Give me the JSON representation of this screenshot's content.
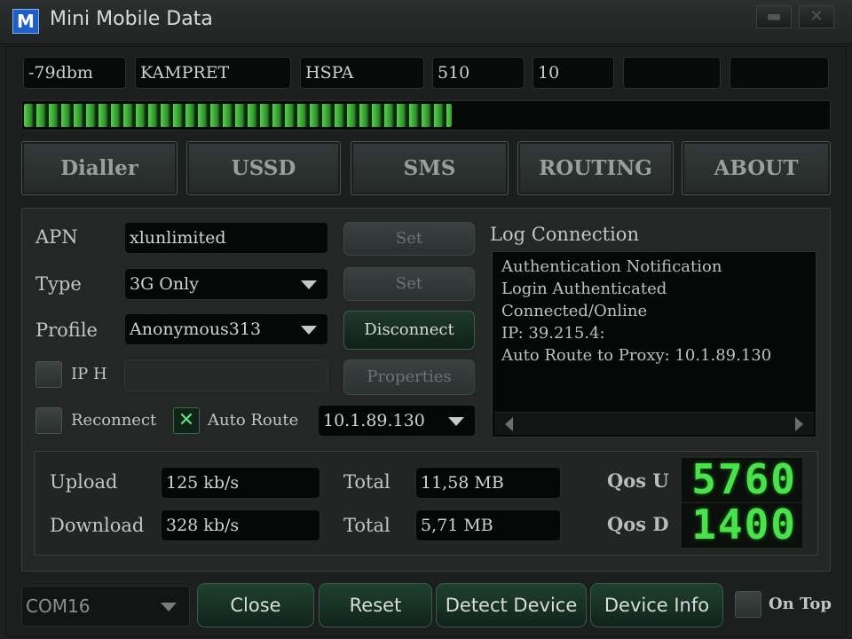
{
  "window": {
    "icon_letter": "M",
    "title": "Mini Mobile Data",
    "minimize_glyph": "▬",
    "close_glyph": "✕"
  },
  "status": {
    "signal": "-79dbm",
    "operator": "KAMPRET",
    "network": "HSPA",
    "mcc": "510",
    "mnc": "10",
    "extra1": "",
    "extra2": ""
  },
  "signal_strength_percent": 53,
  "tabs": [
    "Dialler",
    "USSD",
    "SMS",
    "ROUTING",
    "ABOUT"
  ],
  "dialler": {
    "apn_label": "APN",
    "apn_value": "xlunlimited",
    "apn_set": "Set",
    "type_label": "Type",
    "type_value": "3G Only",
    "type_set": "Set",
    "profile_label": "Profile",
    "profile_value": "Anonymous313",
    "disconnect": "Disconnect",
    "iph_label": "IP H",
    "iph_value": "",
    "properties": "Properties",
    "reconnect_label": "Reconnect",
    "reconnect_checked": false,
    "autoroute_label": "Auto Route",
    "autoroute_checked": true,
    "autoroute_check_glyph": "✕",
    "autoroute_value": "10.1.89.130"
  },
  "log": {
    "title": "Log Connection",
    "lines": [
      "Authentication Notification",
      "Login Authenticated",
      "Connected/Online",
      "IP: 39.215.4:",
      "Auto Route to Proxy: 10.1.89.130"
    ]
  },
  "stats": {
    "upload_label": "Upload",
    "upload_value": "125 kb/s",
    "upload_total_label": "Total",
    "upload_total": "11,58 MB",
    "download_label": "Download",
    "download_value": "328 kb/s",
    "download_total_label": "Total",
    "download_total": "5,71 MB",
    "qos_u_label": "Qos U",
    "qos_u_value": "5760",
    "qos_d_label": "Qos D",
    "qos_d_value": "1400"
  },
  "footer": {
    "port": "COM16",
    "close": "Close",
    "reset": "Reset",
    "detect": "Detect Device",
    "info": "Device Info",
    "on_top_label": "On Top",
    "on_top_checked": false
  },
  "colors": {
    "accent_green": "#49e24a",
    "background": "#1d2120",
    "button_green": "#20402e"
  }
}
